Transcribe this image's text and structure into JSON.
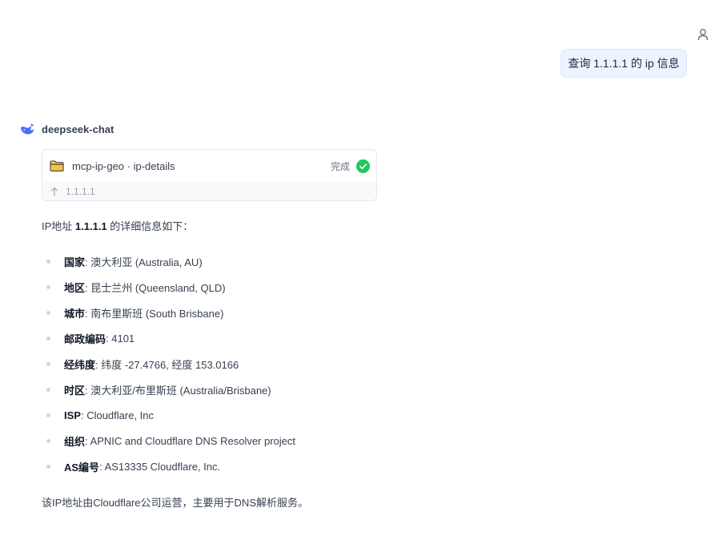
{
  "user_message": "查询 1.1.1.1 的 ip 信息",
  "assistant": {
    "name": "deepseek-chat",
    "tool_call": {
      "name": "mcp-ip-geo · ip-details",
      "status": "完成",
      "argument": "1.1.1.1"
    },
    "intro": {
      "prefix": "IP地址 ",
      "ip": "1.1.1.1",
      "suffix": " 的详细信息如下："
    },
    "items": [
      {
        "label": "国家",
        "value": ": 澳大利亚 (Australia, AU)"
      },
      {
        "label": "地区",
        "value": ": 昆士兰州 (Queensland, QLD)"
      },
      {
        "label": "城市",
        "value": ": 南布里斯班 (South Brisbane)"
      },
      {
        "label": "邮政编码",
        "value": ": 4101"
      },
      {
        "label": "经纬度",
        "value": ": 纬度 -27.4766, 经度 153.0166"
      },
      {
        "label": "时区",
        "value": ": 澳大利亚/布里斯班 (Australia/Brisbane)"
      },
      {
        "label": "ISP",
        "value": ": Cloudflare, Inc"
      },
      {
        "label": "组织",
        "value": ": APNIC and Cloudflare DNS Resolver project"
      },
      {
        "label": "AS编号",
        "value": ": AS13335 Cloudflare, Inc."
      }
    ],
    "outro": "该IP地址由Cloudflare公司运营，主要用于DNS解析服务。"
  },
  "icons": {
    "user": "user-icon",
    "assistant_logo": "whale-logo-icon",
    "tool": "folder-icon",
    "status": "check-circle-icon",
    "argument": "arrow-up-icon"
  },
  "colors": {
    "user_bubble_bg": "#eef4ff",
    "logo_blue": "#4d6bfe",
    "success_green": "#22c55e",
    "folder_yellow": "#f5c542"
  }
}
